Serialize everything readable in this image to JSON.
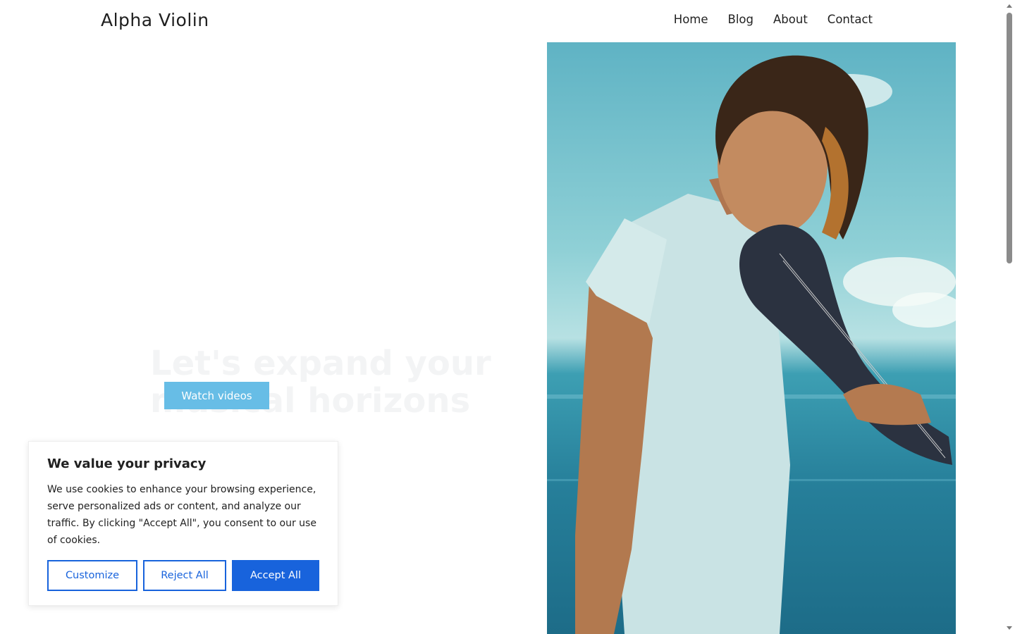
{
  "header": {
    "site_title": "Alpha Violin",
    "nav": [
      "Home",
      "Blog",
      "About",
      "Contact"
    ]
  },
  "hero": {
    "heading": "Let's expand your musical horizons",
    "button_label": "Watch videos"
  },
  "cookie_banner": {
    "title": "We value your privacy",
    "text": "We use cookies to enhance your browsing experience, serve personalized ads or content, and analyze our traffic. By clicking \"Accept All\", you consent to our use of cookies.",
    "customize_label": "Customize",
    "reject_label": "Reject All",
    "accept_label": "Accept All"
  },
  "colors": {
    "accent_blue": "#1863dc",
    "hero_button": "#67bde6"
  }
}
